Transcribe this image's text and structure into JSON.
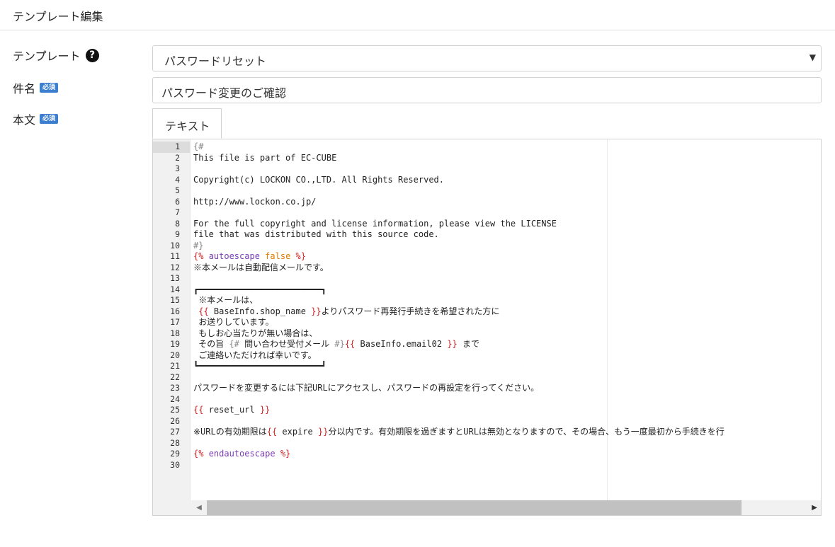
{
  "header": {
    "title": "テンプレート編集"
  },
  "form": {
    "template_label": "テンプレート",
    "template_value": "パスワードリセット",
    "subject_label": "件名",
    "subject_value": "パスワード変更のご確認",
    "body_label": "本文",
    "required_badge": "必須",
    "help_icon": "question-circle-icon",
    "select_arrow": "▼",
    "tab_label": "テキスト"
  },
  "editor": {
    "scroll_left": "◀",
    "scroll_right": "▶",
    "lines": [
      "{#",
      "This file is part of EC-CUBE",
      "",
      "Copyright(c) LOCKON CO.,LTD. All Rights Reserved.",
      "",
      "http://www.lockon.co.jp/",
      "",
      "For the full copyright and license information, please view the LICENSE",
      "file that was distributed with this source code.",
      "#}",
      "{% autoescape false %}",
      "※本メールは自動配信メールです。",
      "",
      "┏━━━━━━━━━━━━━━━━━━━━━━━━┓",
      " ※本メールは、",
      " {{ BaseInfo.shop_name }}よりパスワード再発行手続きを希望された方に",
      " お送りしています。",
      " もしお心当たりが無い場合は、",
      " その旨 {# 問い合わせ受付メール #}{{ BaseInfo.email02 }} まで",
      " ご連絡いただければ幸いです。",
      "┗━━━━━━━━━━━━━━━━━━━━━━━━┛",
      "",
      "パスワードを変更するには下記URLにアクセスし、パスワードの再設定を行ってください。",
      "",
      "{{ reset_url }}",
      "",
      "※URLの有効期限は{{ expire }}分以内です。有効期限を過ぎますとURLは無効となりますので、その場合、もう一度最初から手続きを行",
      "",
      "{% endautoescape %}",
      ""
    ]
  }
}
